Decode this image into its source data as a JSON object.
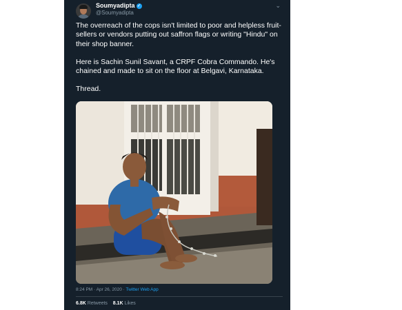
{
  "tweet": {
    "display_name": "Soumyadipta",
    "handle": "@Soumyadipta",
    "paragraphs": [
      "The overreach of the cops isn't limited to poor and helpless fruit-sellers or vendors putting out saffron flags or writing \"Hindu\" on their shop banner.",
      "Here is Sachin Sunil Savant, a CRPF Cobra Commando. He's chained and made to sit on the floor at Belgavi, Karnataka.",
      "Thread."
    ],
    "timestamp": "8:24 PM · Apr 26, 2020",
    "source": "Twitter Web App",
    "retweets_count": "6.8K",
    "retweets_label": "Retweets",
    "likes_count": "8.1K",
    "likes_label": "Likes"
  },
  "icons": [
    "avatar",
    "verified-badge-icon",
    "chevron-down-icon"
  ],
  "colors": {
    "background": "#15202b",
    "accent": "#1da1f2",
    "muted": "#8899a6"
  }
}
